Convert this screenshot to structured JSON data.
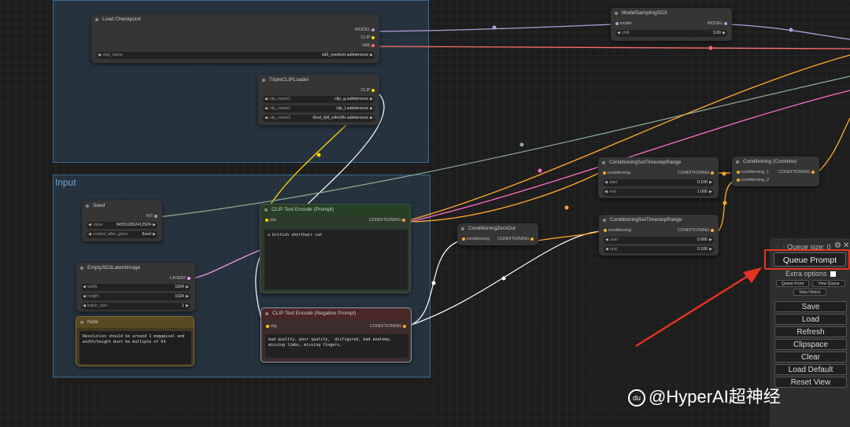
{
  "groups": {
    "input_title": "Input"
  },
  "nodes": {
    "load_checkpoint": {
      "title": "Load Checkpoint",
      "outputs": [
        "MODEL",
        "CLIP",
        "VAE"
      ],
      "ckpt_label": "ckpt_name",
      "ckpt_value": "sd3_medium.safetensors"
    },
    "triple_clip": {
      "title": "TripleCLIPLoader",
      "output": "CLIP",
      "widgets": [
        {
          "label": "clip_name1",
          "value": "clip_g.safetensors"
        },
        {
          "label": "clip_name2",
          "value": "clip_l.safetensors"
        },
        {
          "label": "clip_name3",
          "value": "t5xxl_fp8_e4m3fn.safetensors"
        }
      ]
    },
    "model_sampling": {
      "title": "ModelSamplingSD3",
      "input": "model",
      "output": "MODEL",
      "shift_label": "shift",
      "shift_value": "3.00"
    },
    "seed": {
      "title": "Seed",
      "output": "INT",
      "value_label": "value",
      "value": "945512652412924",
      "control_label": "control_after_gene",
      "control_value": "fixed"
    },
    "clip_text_encode": {
      "title": "CLIP Text Encode (Prompt)",
      "input": "clip",
      "output": "CONDITIONING",
      "text": "a british shorthair cat"
    },
    "clip_text_negative": {
      "title": "CLIP Text Encode (Negative Prompt)",
      "input": "clip",
      "output": "CONDITIONING",
      "text": "bad quality, poor quality,  disfigured, bad anatomy,\nmissing limbs, missing fingers,"
    },
    "empty_latent": {
      "title": "EmptySD3LatentImage",
      "output": "LATENT",
      "widgets": [
        {
          "label": "width",
          "value": "1024"
        },
        {
          "label": "height",
          "value": "1024"
        },
        {
          "label": "batch_size",
          "value": "1"
        }
      ]
    },
    "note": {
      "title": "Note",
      "text": "Resolution should be around 1 megapixel and\nwidth/height must be multiple of 64"
    },
    "cond_zero_out": {
      "title": "ConditioningZeroOut",
      "input": "conditioning",
      "output": "CONDITIONING"
    },
    "cond_range1": {
      "title": "ConditioningSetTimestepRange",
      "input": "conditioning",
      "output": "CONDITIONING",
      "widgets": [
        {
          "label": "start",
          "value": "0.100"
        },
        {
          "label": "end",
          "value": "1.000"
        }
      ]
    },
    "cond_range2": {
      "title": "ConditioningSetTimestepRange",
      "input": "conditioning",
      "output": "CONDITIONING",
      "widgets": [
        {
          "label": "start",
          "value": "0.000"
        },
        {
          "label": "end",
          "value": "0.100"
        }
      ]
    },
    "cond_combine": {
      "title": "Conditioning (Combine)",
      "inputs": [
        "conditioning_1",
        "conditioning_2"
      ],
      "output": "CONDITIONING"
    }
  },
  "menu": {
    "queue_size": "Queue size: 0",
    "queue_prompt": "Queue Prompt",
    "extra_options": "Extra options",
    "queue_front": "Queue Front",
    "view_queue": "View Queue",
    "view_history": "View History",
    "save": "Save",
    "load": "Load",
    "refresh": "Refresh",
    "clipspace": "Clipspace",
    "clear": "Clear",
    "load_default": "Load Default",
    "reset_view": "Reset View"
  },
  "watermark": "@HyperAI超神经",
  "colors": {
    "model": "#b39ddb",
    "clip": "#ffd500",
    "vae": "#ff6e6e",
    "conditioning": "#ffa931",
    "latent": "#ff9cf9",
    "int": "#7bb58b",
    "annotation": "#e53323"
  }
}
